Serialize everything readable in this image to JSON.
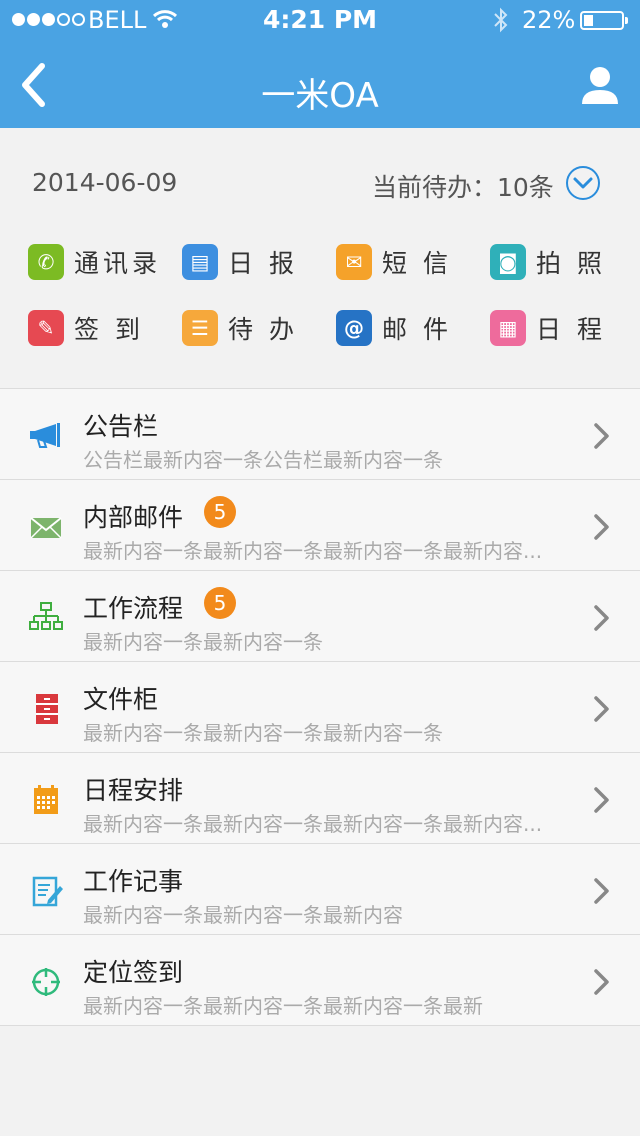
{
  "status_bar": {
    "carrier": "BELL",
    "time": "4:21 PM",
    "battery": "22%",
    "battery_level": 0.22,
    "signal_bars_filled": 3,
    "signal_bars_total": 5
  },
  "nav": {
    "title": "一米OA",
    "back_icon": "chevron-left-icon",
    "user_icon": "user-icon"
  },
  "summary": {
    "date": "2014-06-09",
    "todo": "当前待办：10条"
  },
  "quick_actions": [
    {
      "label": "通讯录",
      "icon": "phone-icon",
      "color": "#7cbb23",
      "glyph": "✆"
    },
    {
      "label": "日 报",
      "icon": "document-icon",
      "color": "#3d8fe0",
      "glyph": "▤"
    },
    {
      "label": "短 信",
      "icon": "envelope-icon",
      "color": "#f5a22a",
      "glyph": "✉"
    },
    {
      "label": "拍 照",
      "icon": "camera-icon",
      "color": "#2fb0b9",
      "glyph": "◙"
    },
    {
      "label": "签 到",
      "icon": "pencil-icon",
      "color": "#e64952",
      "glyph": "✎"
    },
    {
      "label": "待 办",
      "icon": "list-icon",
      "color": "#f6a83b",
      "glyph": "☰"
    },
    {
      "label": "邮 件",
      "icon": "at-icon",
      "color": "#2673c5",
      "glyph": "@"
    },
    {
      "label": "日 程",
      "icon": "calendar-icon",
      "color": "#ee6b9c",
      "glyph": "▦"
    }
  ],
  "modules": [
    {
      "title": "公告栏",
      "subtitle": "公告栏最新内容一条公告栏最新内容一条",
      "badge": "",
      "icon": "megaphone-icon",
      "color": "#2a8ddc"
    },
    {
      "title": "内部邮件",
      "subtitle": "最新内容一条最新内容一条最新内容一条最新内容...",
      "badge": "5",
      "icon": "mail-icon",
      "color": "#7db46c"
    },
    {
      "title": "工作流程",
      "subtitle": "最新内容一条最新内容一条",
      "badge": "5",
      "icon": "org-chart-icon",
      "color": "#3fae3f"
    },
    {
      "title": "文件柜",
      "subtitle": "最新内容一条最新内容一条最新内容一条",
      "badge": "",
      "icon": "cabinet-icon",
      "color": "#d9383d"
    },
    {
      "title": "日程安排",
      "subtitle": "最新内容一条最新内容一条最新内容一条最新内容...",
      "badge": "",
      "icon": "calendar-icon",
      "color": "#f29c18"
    },
    {
      "title": "工作记事",
      "subtitle": "最新内容一条最新内容一条最新内容",
      "badge": "",
      "icon": "notepad-icon",
      "color": "#35a6d8"
    },
    {
      "title": "定位签到",
      "subtitle": "最新内容一条最新内容一条最新内容一条最新",
      "badge": "",
      "icon": "crosshair-icon",
      "color": "#2fba7c"
    }
  ]
}
